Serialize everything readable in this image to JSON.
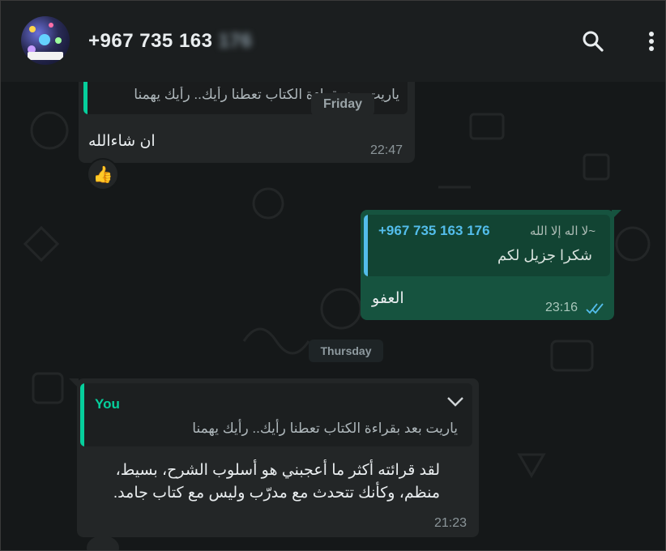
{
  "header": {
    "contact_visible": "+967 735 163",
    "contact_blurred": "176",
    "search_icon": "search-icon",
    "menu_icon": "more-vert-icon"
  },
  "messages": {
    "m1": {
      "quote_text": "ياريت بعد بقراءة الكتاب تعطنا رأيك.. رأيك يهمنا",
      "text": "ان شاءالله",
      "time": "22:47",
      "reaction": "👍"
    },
    "m2": {
      "quote_author": "+967 735 163 176",
      "quote_author_alias": "~لا اله إلا الله",
      "quote_text": "شكرا جزيل لكم",
      "text": "العفو",
      "time": "23:16",
      "status": "read-double-tick"
    },
    "m3": {
      "quote_author": "You",
      "quote_text": "ياريت بعد بقراءة الكتاب تعطنا رأيك.. رأيك يهمنا",
      "text_line1": "لقد قرائته أكثر ما أعجبني هو أسلوب الشرح، بسيط،",
      "text_line2": "منظم، وكأنك تتحدث مع مدرّب وليس مع كتاب جامد.",
      "time": "21:23"
    }
  },
  "dates": {
    "friday": "Friday",
    "thursday": "Thursday"
  },
  "colors": {
    "outgoing_bubble": "#16533f",
    "incoming_bubble": "#232627",
    "accent_green": "#06cf9c",
    "accent_blue": "#53bdeb",
    "read_tick": "#53bdeb"
  }
}
